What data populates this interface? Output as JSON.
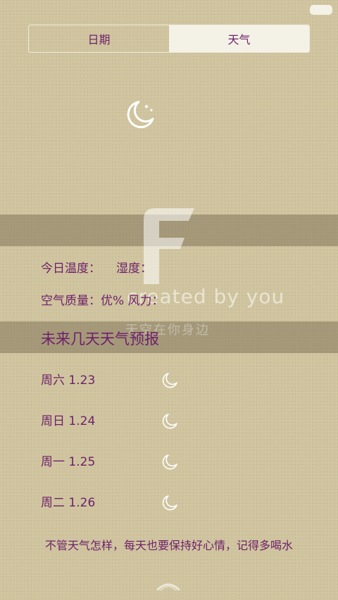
{
  "tabs": [
    {
      "label": "日期",
      "active": false
    },
    {
      "label": "天气",
      "active": true
    }
  ],
  "current_weather_icon": "moon-stars-icon",
  "splash": {
    "logo_letter": "F",
    "tagline_en": "created by you",
    "tagline_cn": "天空在你身边"
  },
  "info": {
    "temperature_label": "今日温度：",
    "humidity_label": "湿度：",
    "air_quality_label": "空气质量：",
    "air_quality_value": "优%",
    "wind_label": "风力："
  },
  "forecast": {
    "title": "未来几天天气预报",
    "days": [
      {
        "date": "周六 1.23",
        "icon": "moon-icon"
      },
      {
        "date": "周日 1.24",
        "icon": "moon-icon"
      },
      {
        "date": "周一 1.25",
        "icon": "moon-icon"
      },
      {
        "date": "周二 1.26",
        "icon": "moon-icon"
      }
    ]
  },
  "footer_tip": "不管天气怎样，每天也要保持好心情，记得多喝水",
  "colors": {
    "text_accent": "#6e1f6a",
    "background": "#cfc49e",
    "tab_active": "#f4f1e6"
  }
}
